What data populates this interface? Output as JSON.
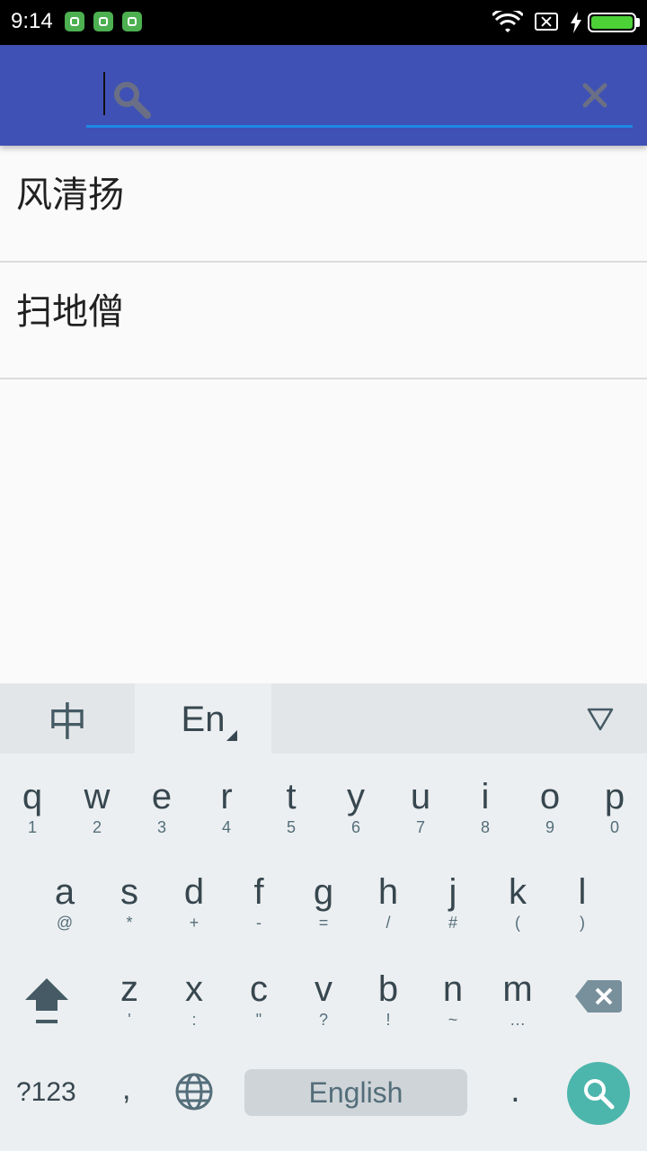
{
  "status": {
    "time": "9:14",
    "battery_color": "#4cd137"
  },
  "search": {
    "value": "",
    "placeholder": ""
  },
  "results": [
    {
      "name": "风清扬"
    },
    {
      "name": "扫地僧"
    }
  ],
  "keyboard": {
    "lang_zh": "中",
    "lang_en": "En",
    "row1": [
      {
        "main": "q",
        "sub": "1"
      },
      {
        "main": "w",
        "sub": "2"
      },
      {
        "main": "e",
        "sub": "3"
      },
      {
        "main": "r",
        "sub": "4"
      },
      {
        "main": "t",
        "sub": "5"
      },
      {
        "main": "y",
        "sub": "6"
      },
      {
        "main": "u",
        "sub": "7"
      },
      {
        "main": "i",
        "sub": "8"
      },
      {
        "main": "o",
        "sub": "9"
      },
      {
        "main": "p",
        "sub": "0"
      }
    ],
    "row2": [
      {
        "main": "a",
        "sub": "@"
      },
      {
        "main": "s",
        "sub": "*"
      },
      {
        "main": "d",
        "sub": "+"
      },
      {
        "main": "f",
        "sub": "-"
      },
      {
        "main": "g",
        "sub": "="
      },
      {
        "main": "h",
        "sub": "/"
      },
      {
        "main": "j",
        "sub": "#"
      },
      {
        "main": "k",
        "sub": "("
      },
      {
        "main": "l",
        "sub": ")"
      }
    ],
    "row3": [
      {
        "main": "z",
        "sub": "'"
      },
      {
        "main": "x",
        "sub": ":"
      },
      {
        "main": "c",
        "sub": "\""
      },
      {
        "main": "v",
        "sub": "?"
      },
      {
        "main": "b",
        "sub": "!"
      },
      {
        "main": "n",
        "sub": "~"
      },
      {
        "main": "m",
        "sub": "…"
      }
    ],
    "symbols_label": "?123",
    "comma": ",",
    "space_label": "English",
    "period": ".",
    "accent_color": "#4db6ac"
  },
  "colors": {
    "appbar": "#3f51b5",
    "underline": "#1e88e5"
  }
}
